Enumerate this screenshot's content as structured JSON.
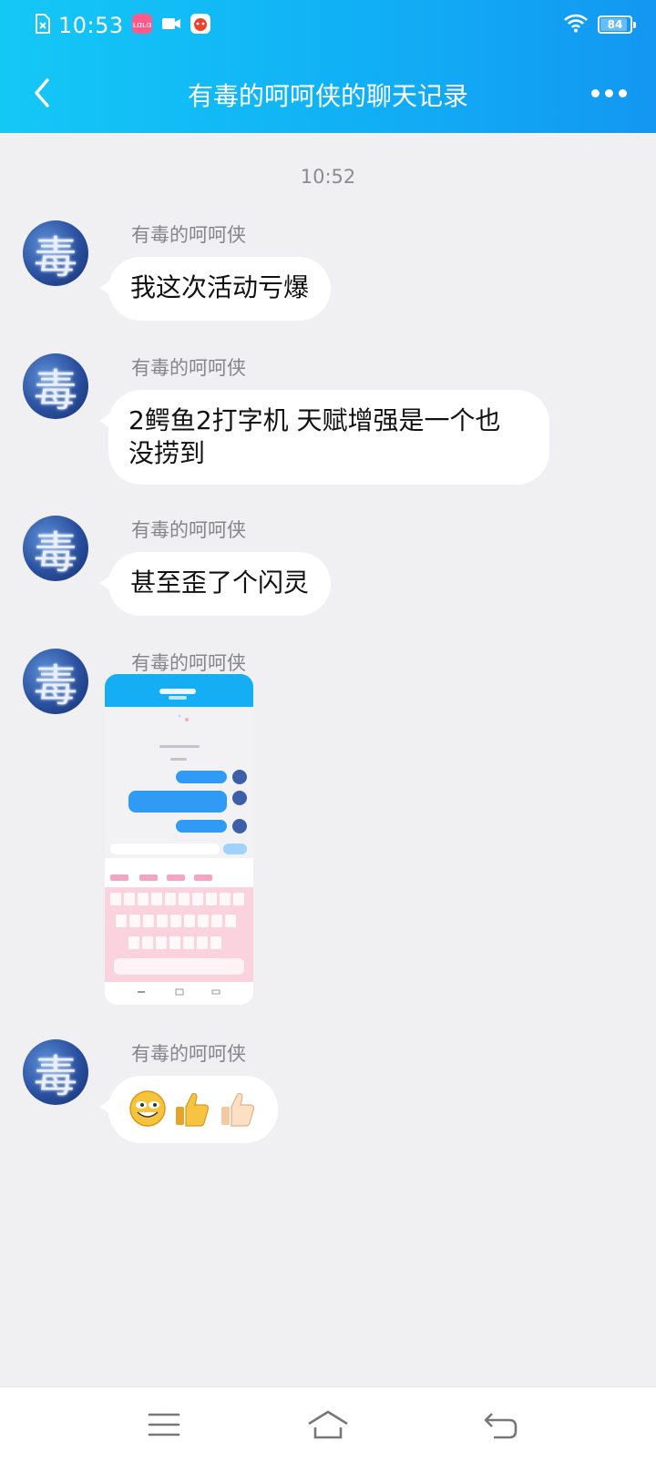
{
  "status_bar": {
    "time": "10:53",
    "battery_level": "84",
    "icons": [
      "sim-off-icon",
      "app-notification-icon",
      "video-icon",
      "game-icon",
      "wifi-icon",
      "battery-icon"
    ]
  },
  "header": {
    "back_icon": "chevron-left-icon",
    "title": "有毒的呵呵侠的聊天记录",
    "more_icon": "more-dots-icon",
    "gradient_colors": [
      "#14c8f6",
      "#1397f2"
    ]
  },
  "chat": {
    "timestamp": "10:52",
    "messages": [
      {
        "sender": "有毒的呵呵侠",
        "type": "text",
        "text": "我这次活动亏爆"
      },
      {
        "sender": "有毒的呵呵侠",
        "type": "text",
        "text_line1": "2鳄鱼2打字机 天赋增强是一个也",
        "text_line2": "没捞到"
      },
      {
        "sender": "有毒的呵呵侠",
        "type": "text",
        "text": "甚至歪了个闪灵"
      },
      {
        "sender": "有毒的呵呵侠",
        "type": "image",
        "image_desc": "screenshot-thumbnail"
      },
      {
        "sender": "有毒的呵呵侠",
        "type": "emoji",
        "emojis": [
          "grin-face-emoji",
          "thumbs-up-emoji",
          "thumbs-up-light-emoji"
        ]
      }
    ],
    "avatar_glyph": "毒"
  },
  "nav_bar": {
    "buttons": [
      "menu-icon",
      "home-icon",
      "back-icon"
    ]
  },
  "colors": {
    "background": "#f0f0f2",
    "bubble": "#ffffff",
    "nickname": "#86868b"
  }
}
